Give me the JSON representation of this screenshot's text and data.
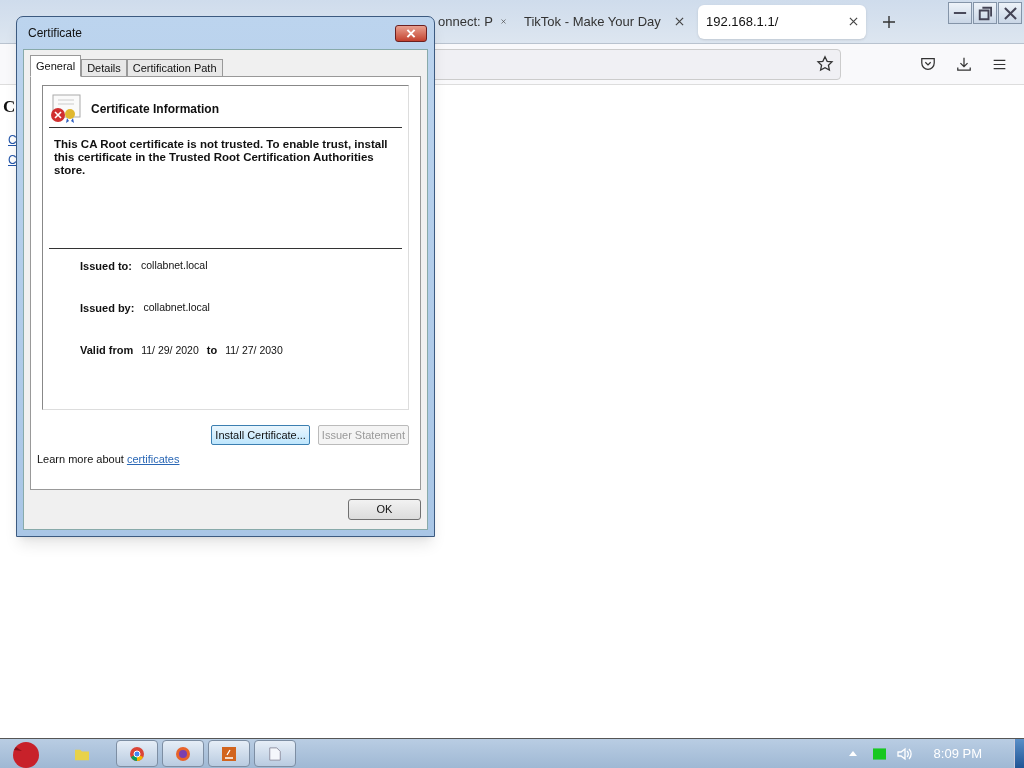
{
  "browser": {
    "tabs": [
      {
        "title": "onnect: P",
        "selected": false
      },
      {
        "title": "TikTok - Make Your Day",
        "selected": false
      },
      {
        "title": "192.168.1.1/",
        "selected": true
      }
    ],
    "page": {
      "heading": "C",
      "links": [
        "C",
        "C"
      ]
    }
  },
  "dialog": {
    "title": "Certificate",
    "tabs": [
      {
        "label": "General",
        "selected": true
      },
      {
        "label": "Details",
        "selected": false
      },
      {
        "label": "Certification Path",
        "selected": false
      }
    ],
    "info_title": "Certificate Information",
    "message": "This CA Root certificate is not trusted. To enable trust, install this certificate in the Trusted Root Certification Authorities store.",
    "fields": [
      {
        "label": "Issued to:",
        "value": "collabnet.local"
      },
      {
        "label": "Issued by:",
        "value": "collabnet.local"
      }
    ],
    "validity": {
      "label": "Valid from",
      "from": "11/ 29/ 2020",
      "separator": "to",
      "to": "11/ 27/ 2030"
    },
    "buttons": [
      {
        "label": "Install Certificate...",
        "disabled": false
      },
      {
        "label": "Issuer Statement",
        "disabled": true
      }
    ],
    "learn_more": {
      "text": "Learn more about",
      "link": "certificates"
    },
    "ok": "OK"
  },
  "taskbar": {
    "time": "8:09 PM"
  }
}
